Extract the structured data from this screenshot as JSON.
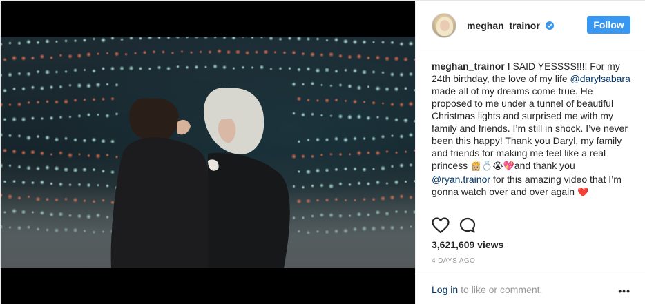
{
  "header": {
    "username": "meghan_trainor",
    "follow_label": "Follow"
  },
  "caption": {
    "username": "meghan_trainor",
    "part1": "I SAID YESSSS!!!! For my 24th birthday, the love of my life ",
    "mention1": "@darylsabara",
    "part2": " made all of my dreams come true. He proposed to me under a tunnel of beautiful Christmas lights and surprised me with my family and friends. I’m still in shock. I’ve never been this happy! Thank you Daryl, my family and friends for making me feel like a real princess ",
    "emoji1": "👸🏼💍😭💖",
    "part3": "and thank you ",
    "mention2": "@ryan.trainor",
    "part4": " for this amazing video that I’m gonna watch over and over again ",
    "emoji2": "❤️"
  },
  "stats": {
    "views": "3,621,609 views",
    "time": "4 DAYS AGO"
  },
  "footer": {
    "login_label": "Log in",
    "rest": "to like or comment.",
    "more_label": "•••"
  },
  "colors": {
    "follow_bg": "#3897f0",
    "link": "#003569",
    "muted": "#999999"
  },
  "icons": [
    "heart-icon",
    "comment-icon",
    "verified-badge-icon",
    "more-options-icon"
  ]
}
